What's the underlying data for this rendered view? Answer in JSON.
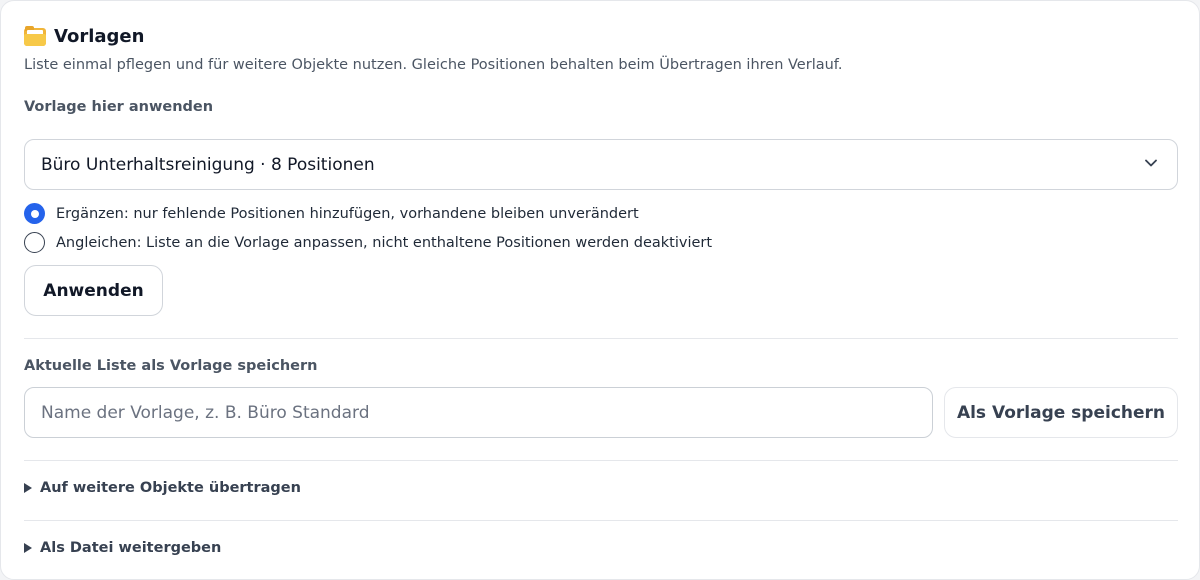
{
  "header": {
    "icon": "folder-icon",
    "title": "Vorlagen",
    "subtitle": "Liste einmal pflegen und für weitere Objekte nutzen. Gleiche Positionen behalten beim Übertragen ihren Verlauf."
  },
  "apply": {
    "label": "Vorlage hier anwenden",
    "select_value": "Büro Unterhaltsreinigung · 8 Positionen",
    "options": [
      {
        "label": "Ergänzen: nur fehlende Positionen hinzufügen, vorhandene bleiben unverändert",
        "checked": true
      },
      {
        "label": "Angleichen: Liste an die Vorlage anpassen, nicht enthaltene Positionen werden deaktiviert",
        "checked": false
      }
    ],
    "button_label": "Anwenden"
  },
  "save": {
    "label": "Aktuelle Liste als Vorlage speichern",
    "input_value": "",
    "input_placeholder": "Name der Vorlage, z. B. Büro Standard",
    "button_label": "Als Vorlage speichern"
  },
  "sections": [
    {
      "label": "Auf weitere Objekte übertragen",
      "expanded": false
    },
    {
      "label": "Als Datei weitergeben",
      "expanded": false
    }
  ],
  "colors": {
    "accent": "#2563eb",
    "border": "#d1d5db",
    "text": "#1f2937",
    "muted": "#4b5563"
  }
}
